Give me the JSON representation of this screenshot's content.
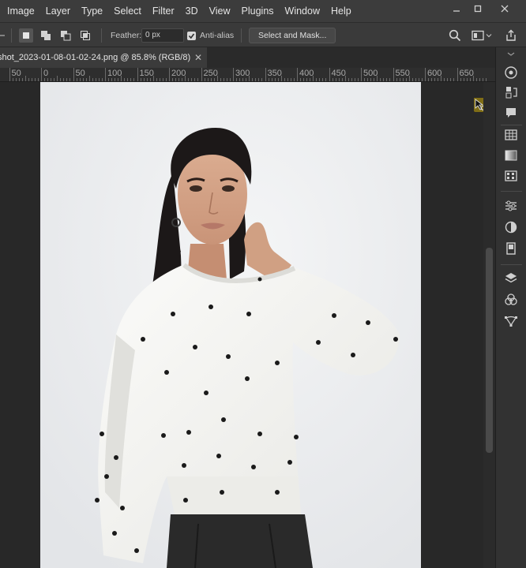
{
  "menu": [
    "Image",
    "Layer",
    "Type",
    "Select",
    "Filter",
    "3D",
    "View",
    "Plugins",
    "Window",
    "Help"
  ],
  "options": {
    "feather_label": "Feather:",
    "feather_value": "0 px",
    "antialias_label": "Anti-alias",
    "antialias_checked": true,
    "mask_button": "Select and Mask..."
  },
  "document": {
    "tab_title": "shot_2023-01-08-01-02-24.png @ 85.8% (RGB/8)",
    "zoom": "85.8%"
  },
  "ruler": {
    "labels": [
      "50",
      "0",
      "50",
      "100",
      "150",
      "200",
      "250",
      "300",
      "350",
      "400",
      "450",
      "500",
      "550",
      "600",
      "650"
    ]
  },
  "panel_icons": [
    "learn-icon",
    "adjustments-history-icon",
    "comments-icon",
    "swatches-icon",
    "gradients-icon",
    "patterns-icon",
    "properties-icon",
    "adjustments-icon",
    "libraries-icon",
    "layers-icon",
    "channels-icon",
    "paths-icon"
  ],
  "colors": {
    "menubar": "#3c3c3c",
    "workspace": "#282828",
    "canvas_bg": "#eceef0",
    "sweater": "#f7f7f4",
    "hair": "#1c1818"
  }
}
